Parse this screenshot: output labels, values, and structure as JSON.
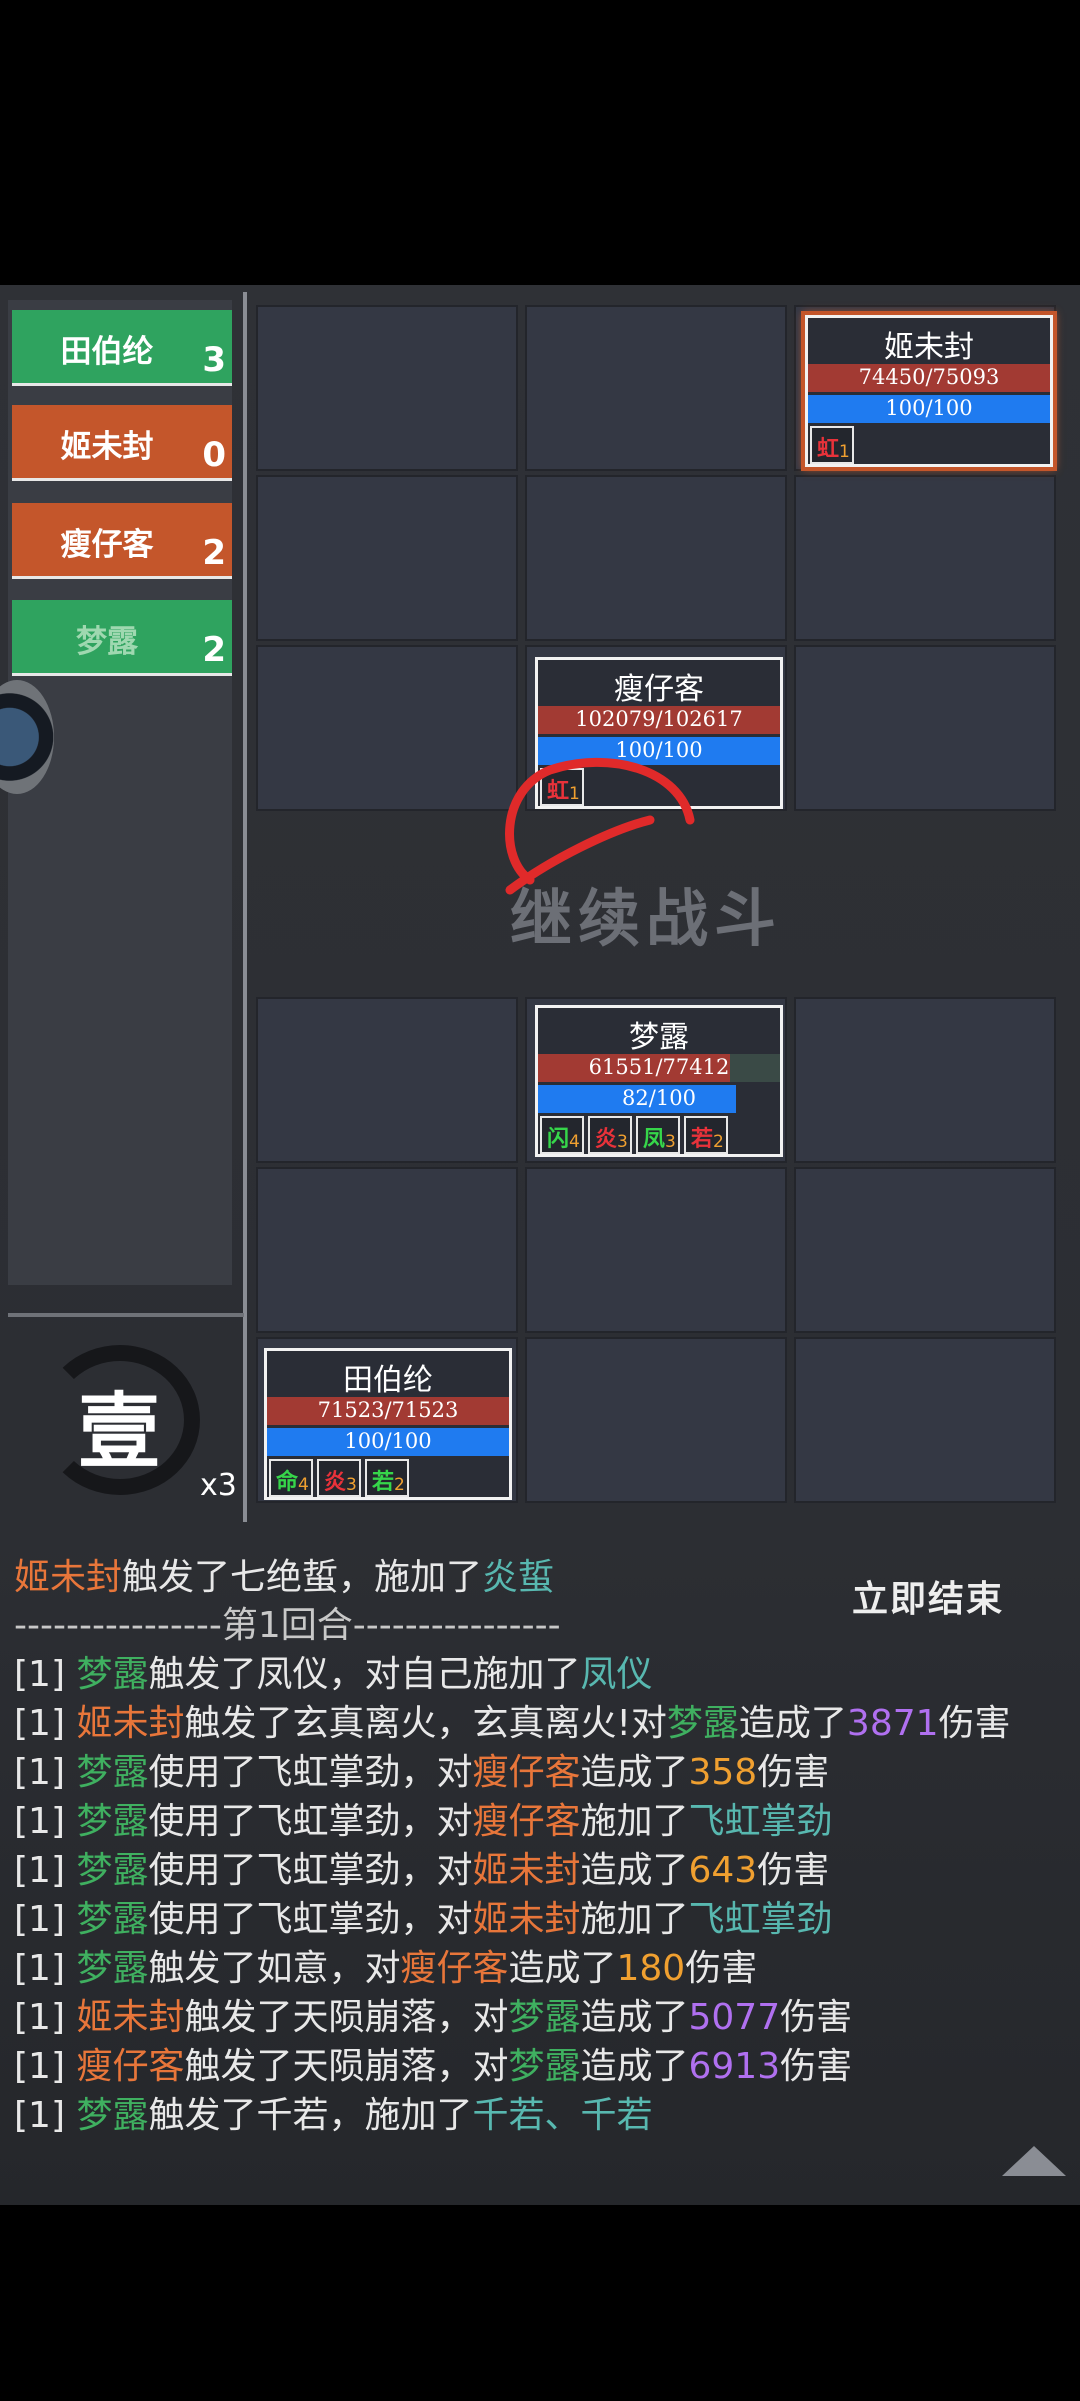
{
  "sidebar": {
    "units": [
      {
        "name": "田伯纶",
        "count": "3",
        "color": "#2fa35f"
      },
      {
        "name": "姬未封",
        "count": "0",
        "color": "#c4562b"
      },
      {
        "name": "瘦仔客",
        "count": "2",
        "color": "#c4562b"
      },
      {
        "name": "梦露",
        "count": "2",
        "color": "#2fa35f"
      }
    ],
    "round_char": "壹",
    "speed": "x3"
  },
  "board": {
    "continue_label": "继续战斗",
    "cards": [
      {
        "name": "姬未封",
        "hp": "74450/75093",
        "hp_fraction": 0.991,
        "mp": "100/100",
        "mp_fraction": 1.0,
        "statuses": [
          {
            "char": "虹",
            "num": "1",
            "color": "red"
          }
        ]
      },
      {
        "name": "瘦仔客",
        "hp": "102079/102617",
        "hp_fraction": 0.995,
        "mp": "100/100",
        "mp_fraction": 1.0,
        "statuses": [
          {
            "char": "虹",
            "num": "1",
            "color": "red"
          }
        ]
      },
      {
        "name": "梦露",
        "hp": "61551/77412",
        "hp_fraction": 0.795,
        "mp": "82/100",
        "mp_fraction": 0.82,
        "statuses": [
          {
            "char": "闪",
            "num": "4",
            "color": "green"
          },
          {
            "char": "炎",
            "num": "3",
            "color": "red"
          },
          {
            "char": "凤",
            "num": "3",
            "color": "green"
          },
          {
            "char": "若",
            "num": "2",
            "color": "red"
          }
        ]
      },
      {
        "name": "田伯纶",
        "hp": "71523/71523",
        "hp_fraction": 1.0,
        "mp": "100/100",
        "mp_fraction": 1.0,
        "statuses": [
          {
            "char": "命",
            "num": "4",
            "color": "green"
          },
          {
            "char": "炎",
            "num": "3",
            "color": "red"
          },
          {
            "char": "若",
            "num": "2",
            "color": "green"
          }
        ]
      }
    ]
  },
  "log": {
    "end_button": "立即结束",
    "lines": [
      [
        {
          "t": "姬未封",
          "c": "c-orange"
        },
        {
          "t": "触发了七绝蜇，施加了",
          "c": "c-white"
        },
        {
          "t": "炎蜇",
          "c": "c-teal"
        }
      ],
      [
        {
          "t": "----------------第1回合----------------",
          "c": "c-gray"
        }
      ],
      [
        {
          "t": "[1] ",
          "c": "c-white"
        },
        {
          "t": "梦露",
          "c": "c-green"
        },
        {
          "t": "触发了凤仪，对自己施加了",
          "c": "c-white"
        },
        {
          "t": "凤仪",
          "c": "c-teal"
        }
      ],
      [
        {
          "t": "[1] ",
          "c": "c-white"
        },
        {
          "t": "姬未封",
          "c": "c-orange"
        },
        {
          "t": "触发了玄真离火，玄真离火!对",
          "c": "c-white"
        },
        {
          "t": "梦露",
          "c": "c-green"
        },
        {
          "t": "造成了",
          "c": "c-white"
        },
        {
          "t": "3871",
          "c": "c-purple"
        },
        {
          "t": "伤害",
          "c": "c-white"
        }
      ],
      [
        {
          "t": "[1] ",
          "c": "c-white"
        },
        {
          "t": "梦露",
          "c": "c-green"
        },
        {
          "t": "使用了飞虹掌劲，对",
          "c": "c-white"
        },
        {
          "t": "瘦仔客",
          "c": "c-orange"
        },
        {
          "t": "造成了",
          "c": "c-white"
        },
        {
          "t": "358",
          "c": "c-num"
        },
        {
          "t": "伤害",
          "c": "c-white"
        }
      ],
      [
        {
          "t": "[1] ",
          "c": "c-white"
        },
        {
          "t": "梦露",
          "c": "c-green"
        },
        {
          "t": "使用了飞虹掌劲，对",
          "c": "c-white"
        },
        {
          "t": "瘦仔客",
          "c": "c-orange"
        },
        {
          "t": "施加了",
          "c": "c-white"
        },
        {
          "t": "飞虹掌劲",
          "c": "c-teal"
        }
      ],
      [
        {
          "t": "[1] ",
          "c": "c-white"
        },
        {
          "t": "梦露",
          "c": "c-green"
        },
        {
          "t": "使用了飞虹掌劲，对",
          "c": "c-white"
        },
        {
          "t": "姬未封",
          "c": "c-orange"
        },
        {
          "t": "造成了",
          "c": "c-white"
        },
        {
          "t": "643",
          "c": "c-num"
        },
        {
          "t": "伤害",
          "c": "c-white"
        }
      ],
      [
        {
          "t": "[1] ",
          "c": "c-white"
        },
        {
          "t": "梦露",
          "c": "c-green"
        },
        {
          "t": "使用了飞虹掌劲，对",
          "c": "c-white"
        },
        {
          "t": "姬未封",
          "c": "c-orange"
        },
        {
          "t": "施加了",
          "c": "c-white"
        },
        {
          "t": "飞虹掌劲",
          "c": "c-teal"
        }
      ],
      [
        {
          "t": "[1] ",
          "c": "c-white"
        },
        {
          "t": "梦露",
          "c": "c-green"
        },
        {
          "t": "触发了如意，对",
          "c": "c-white"
        },
        {
          "t": "瘦仔客",
          "c": "c-orange"
        },
        {
          "t": "造成了",
          "c": "c-white"
        },
        {
          "t": "180",
          "c": "c-num"
        },
        {
          "t": "伤害",
          "c": "c-white"
        }
      ],
      [
        {
          "t": "[1] ",
          "c": "c-white"
        },
        {
          "t": "姬未封",
          "c": "c-orange"
        },
        {
          "t": "触发了天陨崩落，对",
          "c": "c-white"
        },
        {
          "t": "梦露",
          "c": "c-green"
        },
        {
          "t": "造成了",
          "c": "c-white"
        },
        {
          "t": "5077",
          "c": "c-purple"
        },
        {
          "t": "伤害",
          "c": "c-white"
        }
      ],
      [
        {
          "t": "[1] ",
          "c": "c-white"
        },
        {
          "t": "瘦仔客",
          "c": "c-orange"
        },
        {
          "t": "触发了天陨崩落，对",
          "c": "c-white"
        },
        {
          "t": "梦露",
          "c": "c-green"
        },
        {
          "t": "造成了",
          "c": "c-white"
        },
        {
          "t": "6913",
          "c": "c-purple"
        },
        {
          "t": "伤害",
          "c": "c-white"
        }
      ],
      [
        {
          "t": "[1] ",
          "c": "c-white"
        },
        {
          "t": "梦露",
          "c": "c-green"
        },
        {
          "t": "触发了千若，施加了",
          "c": "c-white"
        },
        {
          "t": "千若、千若",
          "c": "c-teal"
        }
      ]
    ]
  }
}
